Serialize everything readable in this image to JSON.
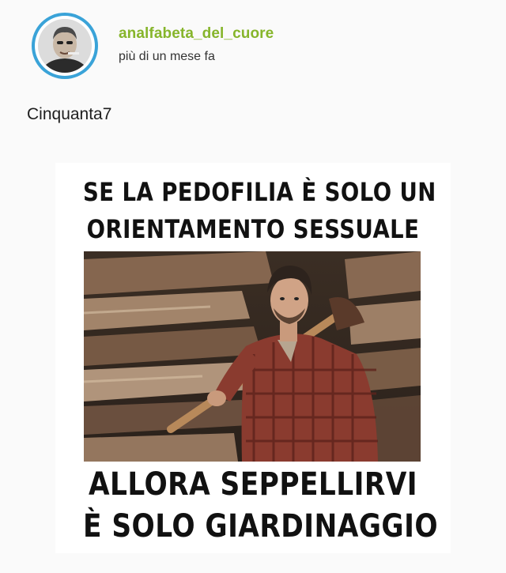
{
  "post": {
    "username": "analfabeta_del_cuore",
    "timestamp": "più di un mese fa",
    "text": "Cinquanta7"
  },
  "meme": {
    "top_line_1": "SE LA PEDOFILIA È SOLO UN",
    "top_line_2": "ORIENTAMENTO SESSUALE",
    "bottom_line_1": "ALLORA SEPPELLIRVI",
    "bottom_line_2": "È SOLO GIARDINAGGIO",
    "image_icon": "man-with-axe-photo"
  },
  "colors": {
    "username": "#86b52b",
    "avatar_ring": "#3aa3d8",
    "background": "#fafafa"
  }
}
